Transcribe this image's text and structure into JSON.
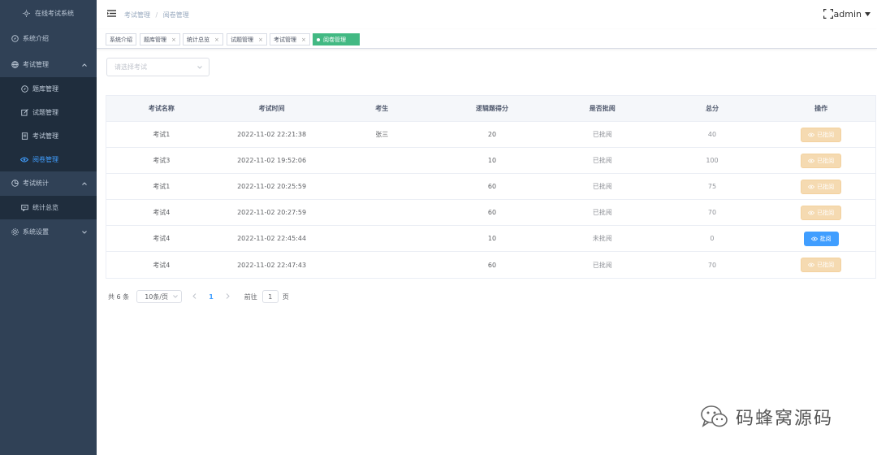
{
  "sidebar": {
    "logo_text": "在线考试系统",
    "items": [
      {
        "label": "系统介绍",
        "icon": "compass-icon",
        "type": "top"
      },
      {
        "label": "考试管理",
        "icon": "globe-icon",
        "type": "top",
        "expanded": true
      },
      {
        "label": "题库管理",
        "icon": "compass-icon",
        "type": "sub"
      },
      {
        "label": "试题管理",
        "icon": "edit-icon",
        "type": "sub"
      },
      {
        "label": "考试管理",
        "icon": "document-icon",
        "type": "sub"
      },
      {
        "label": "阅卷管理",
        "icon": "eye-icon",
        "type": "sub",
        "active": true
      },
      {
        "label": "考试统计",
        "icon": "pie-chart-icon",
        "type": "top",
        "expanded": true
      },
      {
        "label": "统计总览",
        "icon": "chat-icon",
        "type": "sub"
      },
      {
        "label": "系统设置",
        "icon": "gear-icon",
        "type": "top",
        "expanded": false
      }
    ]
  },
  "header": {
    "breadcrumb": [
      "考试管理",
      "阅卷管理"
    ],
    "user": "admin"
  },
  "tags": [
    {
      "label": "系统介绍",
      "closable": false
    },
    {
      "label": "题库管理",
      "closable": true
    },
    {
      "label": "统计总览",
      "closable": true
    },
    {
      "label": "试题管理",
      "closable": true
    },
    {
      "label": "考试管理",
      "closable": true
    },
    {
      "label": "阅卷管理",
      "closable": false,
      "active": true
    }
  ],
  "filter": {
    "placeholder": "请选择考试"
  },
  "table": {
    "columns": [
      "考试名称",
      "考试时间",
      "考生",
      "逻辑题得分",
      "是否批阅",
      "总分",
      "操作"
    ],
    "rows": [
      {
        "name": "考试1",
        "time": "2022-11-02 22:21:38",
        "student": "张三",
        "logic": "20",
        "status": "已批阅",
        "total": "40",
        "action": "已批阅",
        "reviewed": true
      },
      {
        "name": "考试3",
        "time": "2022-11-02 19:52:06",
        "student": "",
        "logic": "10",
        "status": "已批阅",
        "total": "100",
        "action": "已批阅",
        "reviewed": true
      },
      {
        "name": "考试1",
        "time": "2022-11-02 20:25:59",
        "student": "",
        "logic": "60",
        "status": "已批阅",
        "total": "75",
        "action": "已批阅",
        "reviewed": true
      },
      {
        "name": "考试4",
        "time": "2022-11-02 20:27:59",
        "student": "",
        "logic": "60",
        "status": "已批阅",
        "total": "70",
        "action": "已批阅",
        "reviewed": true
      },
      {
        "name": "考试4",
        "time": "2022-11-02 22:45:44",
        "student": "",
        "logic": "10",
        "status": "未批阅",
        "total": "0",
        "action": "批阅",
        "reviewed": false
      },
      {
        "name": "考试4",
        "time": "2022-11-02 22:47:43",
        "student": "",
        "logic": "60",
        "status": "已批阅",
        "total": "70",
        "action": "已批阅",
        "reviewed": true
      }
    ]
  },
  "pagination": {
    "total_text": "共 6 条",
    "page_size": "10条/页",
    "current_page": "1",
    "goto_label": "前往",
    "goto_value": "1",
    "page_unit": "页"
  },
  "watermark": {
    "text": "码蜂窝源码"
  },
  "colors": {
    "sidebar_bg": "#304156",
    "sidebar_sub_bg": "#1f2d3d",
    "active_link": "#409eff",
    "active_tag": "#42b983",
    "reviewed_button": "#f5dab1",
    "review_button": "#409eff"
  }
}
